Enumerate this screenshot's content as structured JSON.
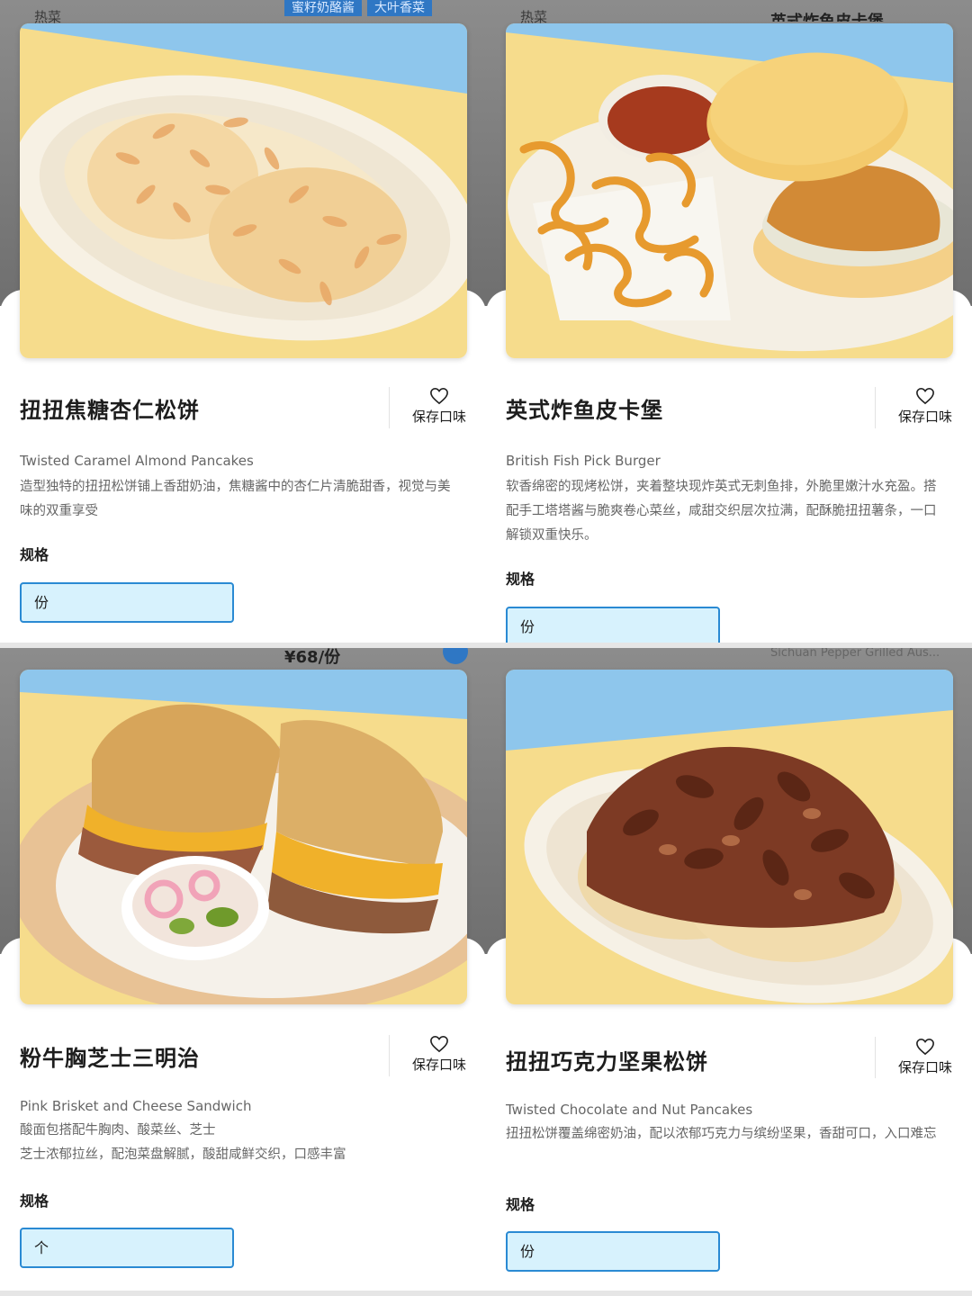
{
  "colors": {
    "accent_border": "#2a8ad3",
    "spec_fill": "#d7f2fd",
    "photo_sky": "#8ec6ec",
    "photo_yellow": "#f6dc8c"
  },
  "panels": [
    {
      "background": {
        "category": "热菜",
        "tags": [
          "蜜籽奶酪酱",
          "大叶香菜"
        ]
      },
      "title": "扭扭焦糖杏仁松饼",
      "favorite_label": "保存口味",
      "favorite_icon": "heart-outline-icon",
      "english_name": "Twisted Caramel Almond Pancakes",
      "description": "造型独特的扭扭松饼铺上香甜奶油，焦糖酱中的杏仁片清脆甜香，视觉与美味的双重享受",
      "spec_title": "规格",
      "spec_option": "份"
    },
    {
      "background": {
        "category": "热菜",
        "title": "英式炸鱼皮卡堡"
      },
      "title": "英式炸鱼皮卡堡",
      "favorite_label": "保存口味",
      "favorite_icon": "heart-outline-icon",
      "english_name": "British Fish Pick Burger",
      "description": "软香绵密的现烤松饼，夹着整块现炸英式无刺鱼排，外脆里嫩汁水充盈。搭配手工塔塔酱与脆爽卷心菜丝，咸甜交织层次拉满，配酥脆扭扭薯条，一口解锁双重快乐。",
      "spec_title": "规格",
      "spec_option": "份"
    },
    {
      "background": {
        "price": "¥68/份"
      },
      "title": "粉牛胸芝士三明治",
      "favorite_label": "保存口味",
      "favorite_icon": "heart-outline-icon",
      "english_name": "Pink Brisket and Cheese Sandwich",
      "description_lines": [
        "酸面包搭配牛胸肉、酸菜丝、芝士",
        "芝士浓郁拉丝，配泡菜盘解腻，酸甜咸鲜交织，口感丰富"
      ],
      "spec_title": "规格",
      "spec_option": "个"
    },
    {
      "background": {
        "subtitle": "Sichuan Pepper Grilled Aus..."
      },
      "title": "扭扭巧克力坚果松饼",
      "favorite_label": "保存口味",
      "favorite_icon": "heart-outline-icon",
      "english_name": "Twisted Chocolate and Nut Pancakes",
      "description": "扭扭松饼覆盖绵密奶油，配以浓郁巧克力与缤纷坚果，香甜可口，入口难忘",
      "spec_title": "规格",
      "spec_option": "份"
    }
  ]
}
